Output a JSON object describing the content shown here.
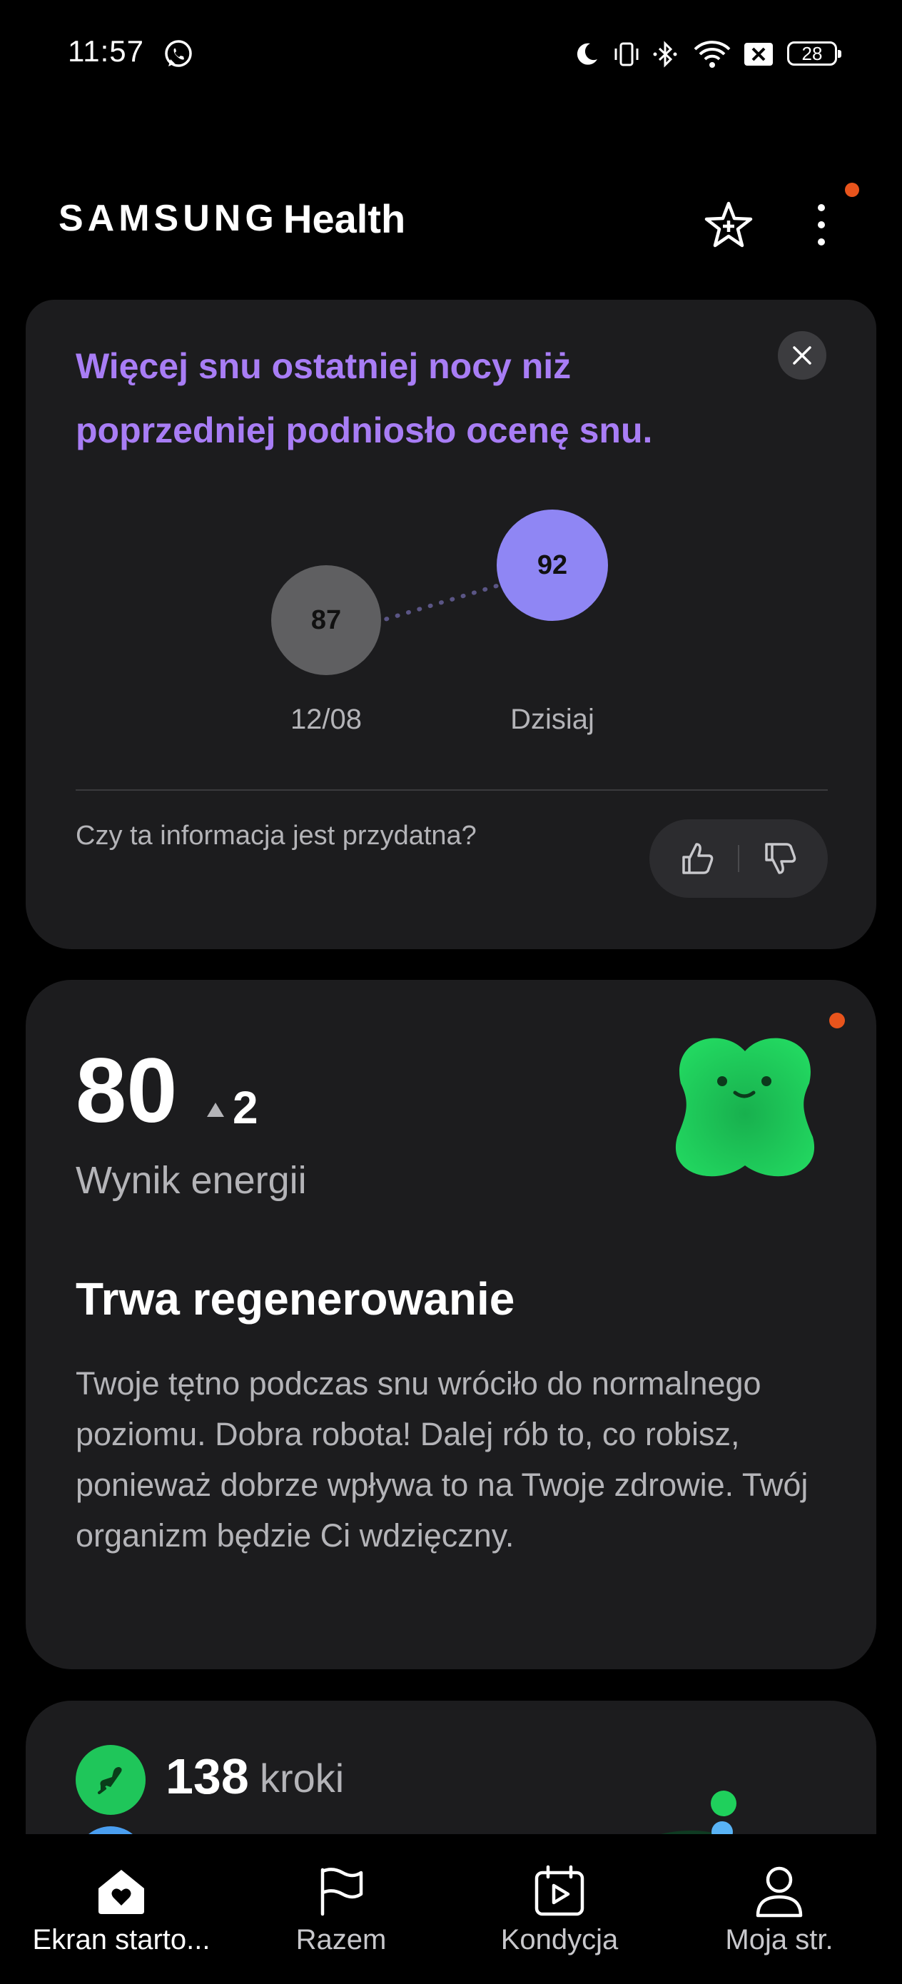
{
  "status_bar": {
    "time": "11:57",
    "battery": "28",
    "icons": [
      "whatsapp-icon",
      "moon-icon",
      "vibrate-icon",
      "bluetooth-icon",
      "wifi-icon",
      "no-sim-icon",
      "battery-icon"
    ]
  },
  "header": {
    "brand": "SAMSUNG",
    "product": "Health",
    "favorites_icon": "star-add-icon",
    "more_icon": "more-vertical-icon",
    "accent_color": "#e8541c"
  },
  "sleep_card": {
    "title": "Więcej snu ostatniej nocy niż poprzedniej podniosło ocenę snu.",
    "previous": {
      "score": "87",
      "label": "12/08"
    },
    "current": {
      "score": "92",
      "label": "Dzisiaj"
    },
    "question": "Czy ta informacja jest przydatna?",
    "title_color": "#a87df5",
    "current_color": "#8f86f4"
  },
  "energy_card": {
    "score": "80",
    "delta": "2",
    "label": "Wynik energii",
    "heading": "Trwa regenerowanie",
    "body": "Twoje tętno podczas snu wróciło do normalnego poziomu. Dobra robota! Dalej rób to, co robisz, ponieważ dobrze wpływa to na Twoje zdrowie. Twój organizm będzie Ci wdzięczny.",
    "mascot_color": "#1fd05c"
  },
  "steps_card": {
    "value": "138",
    "unit": "kroki"
  },
  "bottom_nav": {
    "items": [
      {
        "label": "Ekran starto...",
        "icon": "home-heart-icon"
      },
      {
        "label": "Razem",
        "icon": "flag-icon"
      },
      {
        "label": "Kondycja",
        "icon": "calendar-play-icon"
      },
      {
        "label": "Moja str.",
        "icon": "person-icon"
      }
    ]
  }
}
